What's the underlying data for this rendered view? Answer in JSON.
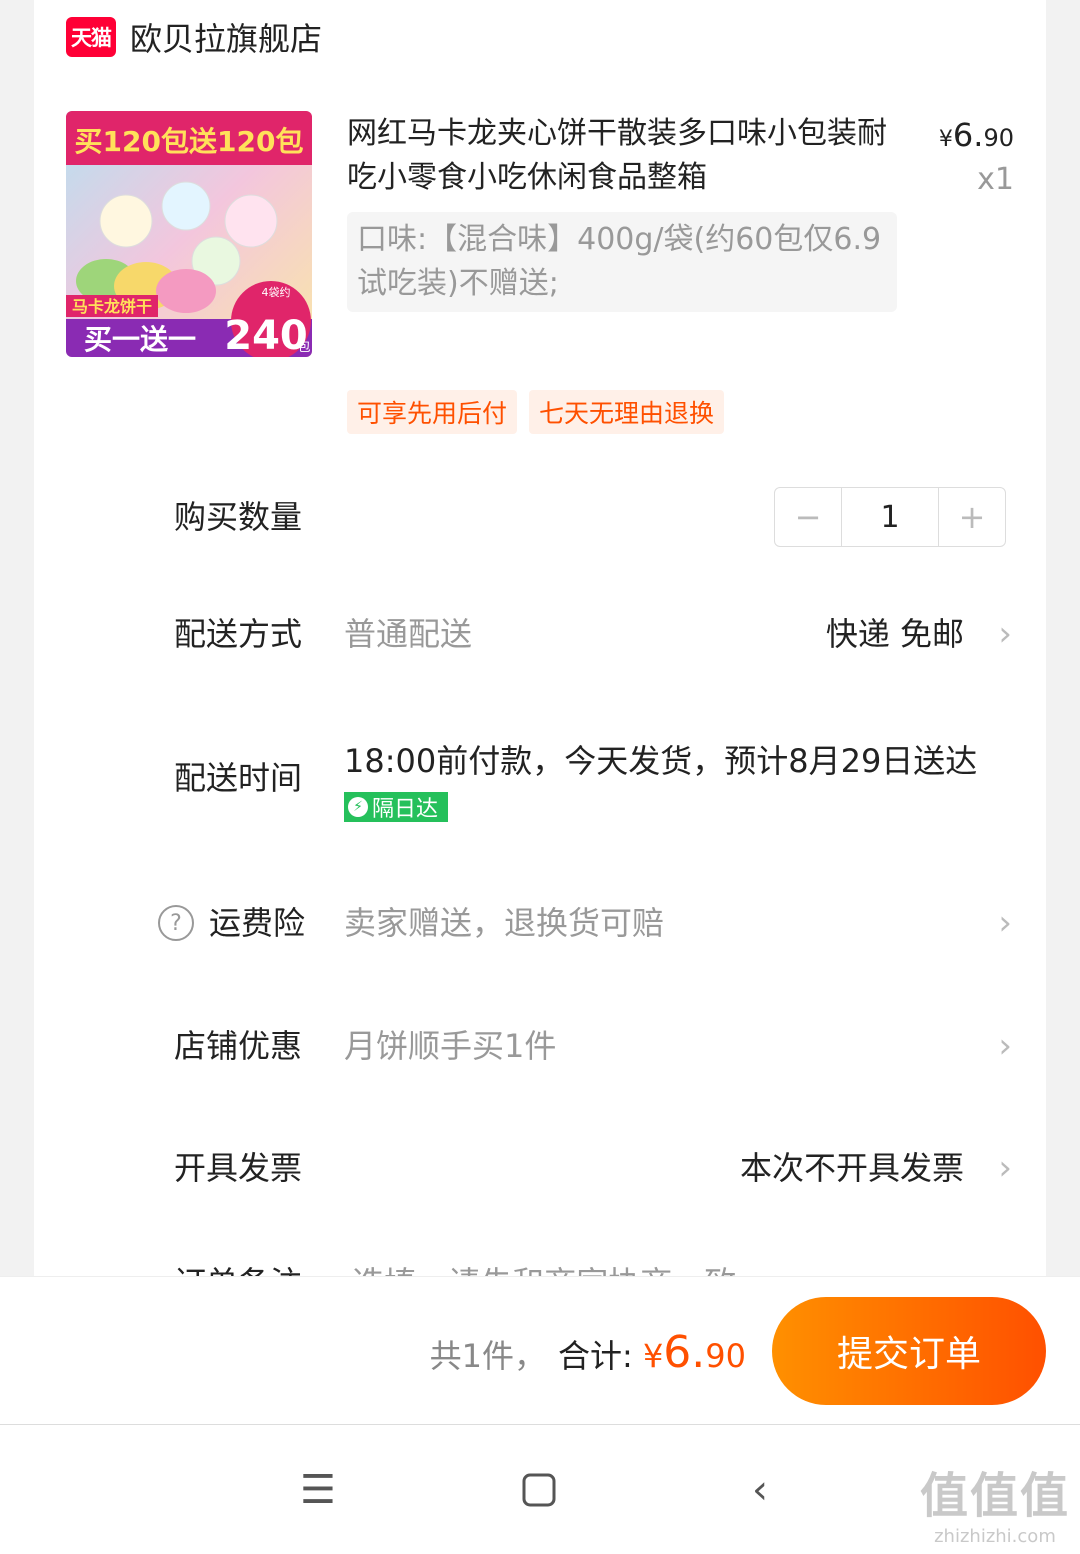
{
  "shop": {
    "badge": "天猫",
    "name": "欧贝拉旗舰店"
  },
  "product": {
    "image_text_top": "买120包送120包",
    "image_text_mid": "马卡龙饼干",
    "image_text_bottom": "买一送一",
    "image_text_count": "240",
    "image_text_unit": "包",
    "image_text_small": "4袋约",
    "title": "网红马卡龙夹心饼干散装多口味小包装耐吃小零食小吃休闲食品整箱",
    "price_symbol": "¥",
    "price_int": "6.",
    "price_dec": "90",
    "qty_mark": "x1",
    "sku": "口味:【混合味】400g/袋(约60包仅6.9试吃装)不赠送;",
    "tags": [
      "可享先用后付",
      "七天无理由退换"
    ]
  },
  "rows": {
    "quantity": {
      "label": "购买数量",
      "minus": "−",
      "value": "1",
      "plus": "+"
    },
    "shipping": {
      "label": "配送方式",
      "value": "普通配送",
      "right": "快递 免邮"
    },
    "delivery_time": {
      "label": "配送时间",
      "value": "18:00前付款，今天发货，预计8月29日送达",
      "badge": "隔日达"
    },
    "freight_insurance": {
      "label": "运费险",
      "value": "卖家赠送，退换货可赔"
    },
    "store_discount": {
      "label": "店铺优惠",
      "value": "月饼顺手买1件"
    },
    "invoice": {
      "label": "开具发票",
      "right": "本次不开具发票"
    },
    "note": {
      "label": "订单备注",
      "value": "选填，请先和商家协商一致"
    }
  },
  "bottom": {
    "count": "共1件，",
    "total_label": "合计:",
    "total_symbol": "¥",
    "total_int": "6.",
    "total_dec": "90",
    "submit": "提交订单"
  },
  "watermark": {
    "big": "值值值",
    "small": "zhizhizhi.com"
  },
  "colors": {
    "accent": "#ff5000",
    "tmall": "#ff0036",
    "nextday": "#25c05b"
  }
}
